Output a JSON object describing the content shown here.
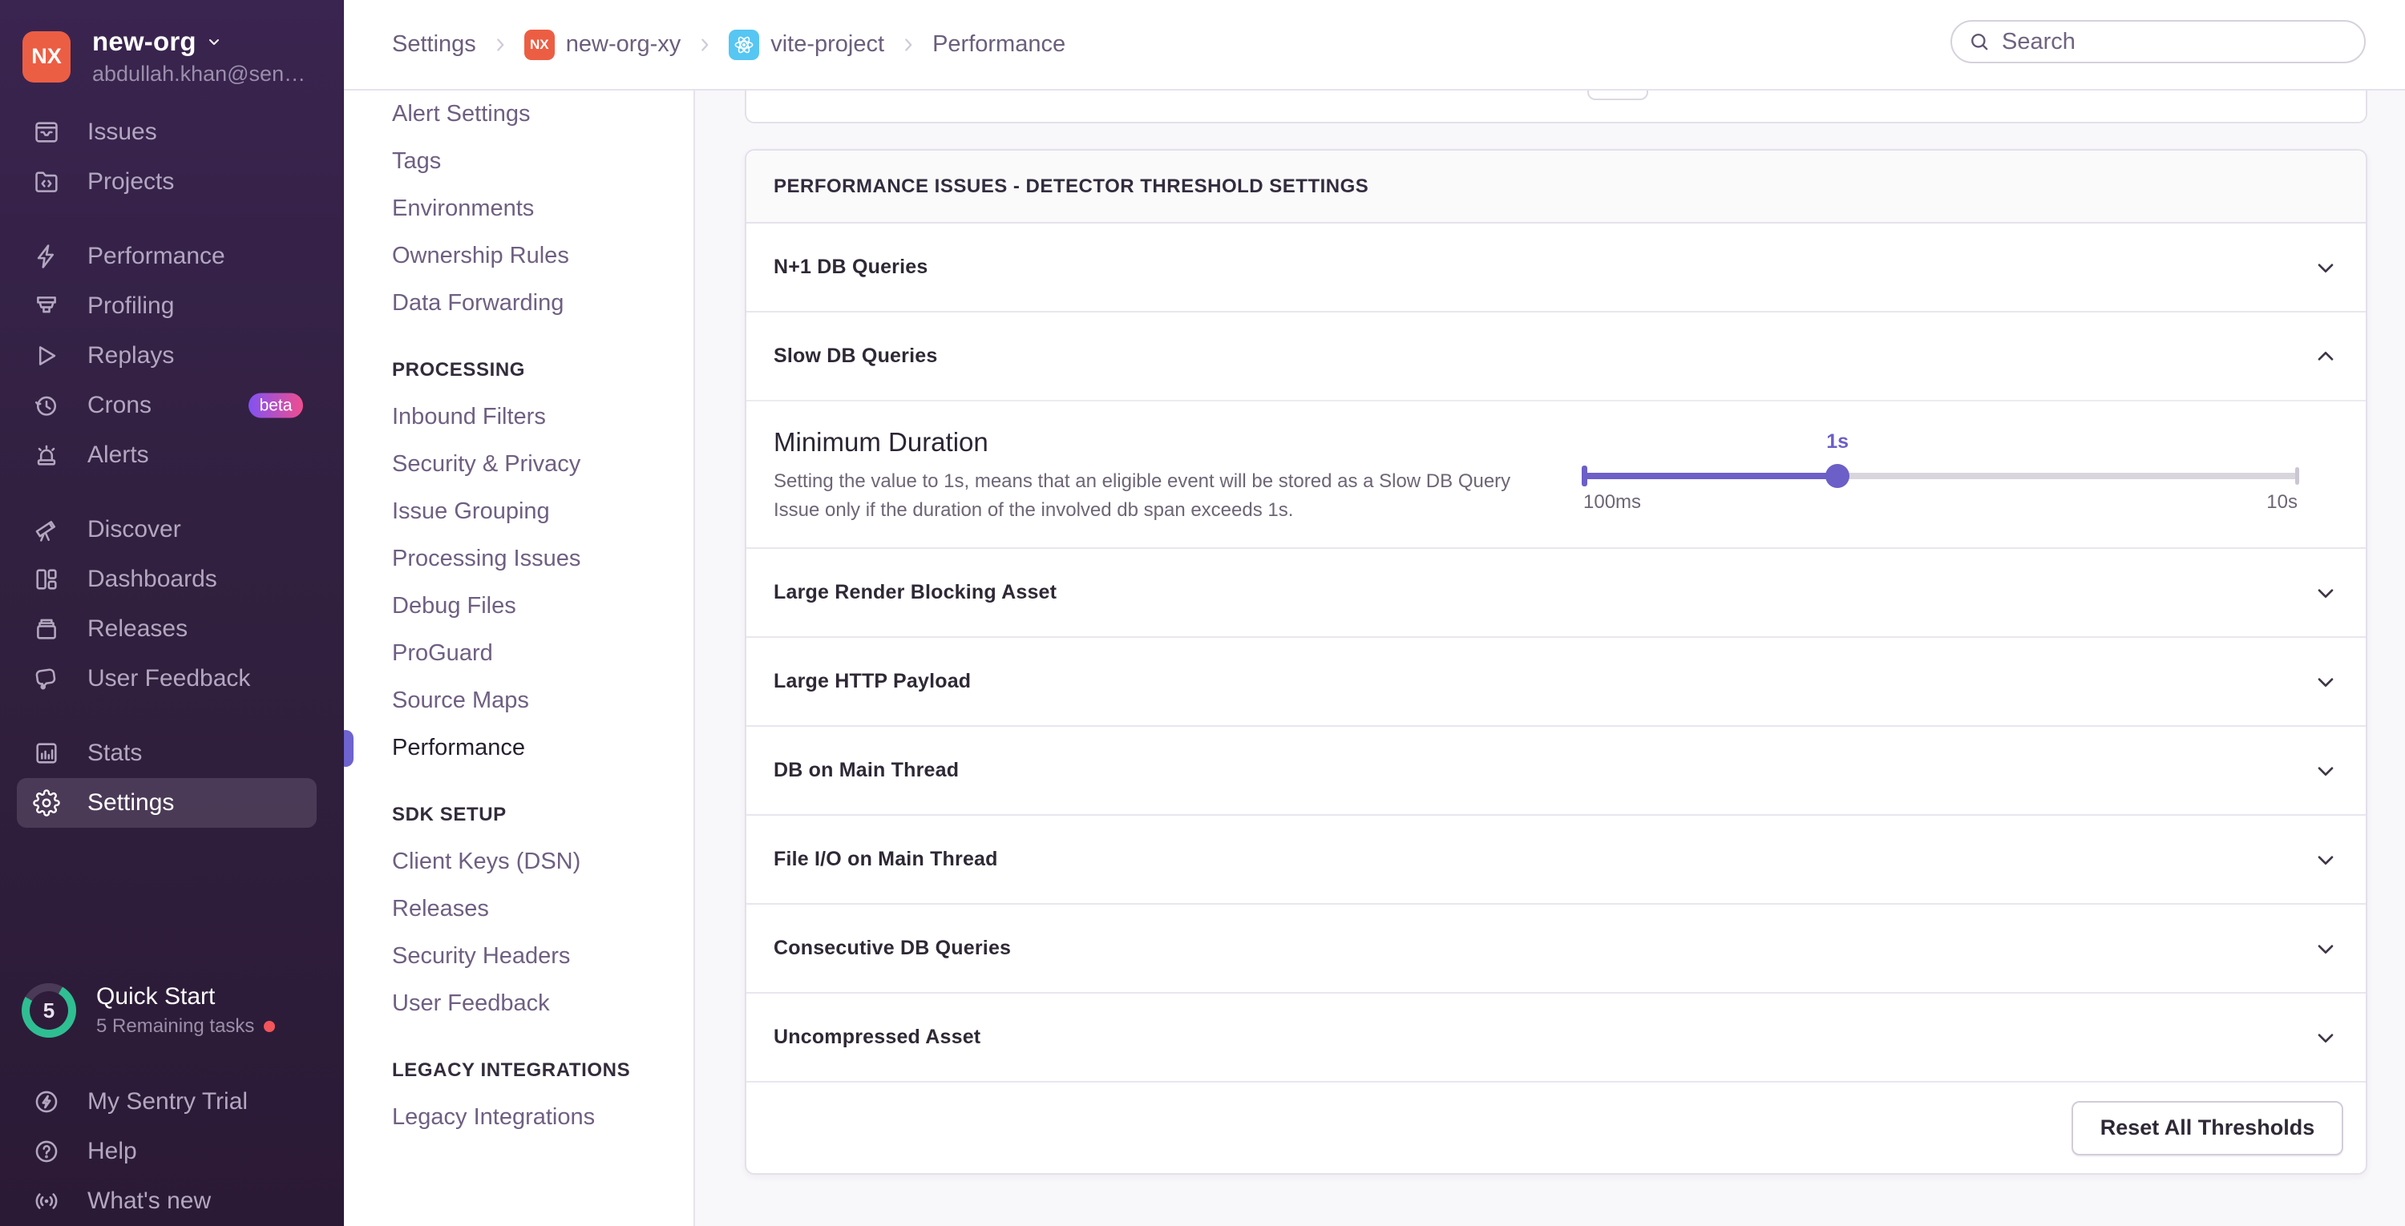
{
  "org": {
    "initials": "NX",
    "name": "new-org",
    "email": "abdullah.khan@sen…"
  },
  "sidebar": {
    "groups": [
      {
        "items": [
          {
            "label": "Issues",
            "icon": "issues-icon"
          },
          {
            "label": "Projects",
            "icon": "projects-icon"
          }
        ]
      },
      {
        "items": [
          {
            "label": "Performance",
            "icon": "performance-icon"
          },
          {
            "label": "Profiling",
            "icon": "profiling-icon"
          },
          {
            "label": "Replays",
            "icon": "replays-icon"
          },
          {
            "label": "Crons",
            "icon": "crons-icon",
            "badge": "beta"
          },
          {
            "label": "Alerts",
            "icon": "alerts-icon"
          }
        ]
      },
      {
        "items": [
          {
            "label": "Discover",
            "icon": "discover-icon"
          },
          {
            "label": "Dashboards",
            "icon": "dashboards-icon"
          },
          {
            "label": "Releases",
            "icon": "releases-icon"
          },
          {
            "label": "User Feedback",
            "icon": "user-feedback-icon"
          }
        ]
      },
      {
        "items": [
          {
            "label": "Stats",
            "icon": "stats-icon"
          },
          {
            "label": "Settings",
            "icon": "gear-icon",
            "active": true
          }
        ]
      }
    ],
    "quick_start": {
      "title": "Quick Start",
      "count": "5",
      "subtitle": "5 Remaining tasks"
    },
    "footer_items": [
      {
        "label": "My Sentry Trial",
        "icon": "trial-icon"
      },
      {
        "label": "Help",
        "icon": "help-icon"
      },
      {
        "label": "What's new",
        "icon": "broadcast-icon"
      }
    ]
  },
  "topbar": {
    "breadcrumbs": [
      {
        "label": "Settings"
      },
      {
        "label": "new-org-xy",
        "badge": "NX"
      },
      {
        "label": "vite-project",
        "badge": "react"
      },
      {
        "label": "Performance"
      }
    ],
    "search_placeholder": "Search"
  },
  "settings_nav": {
    "groups": [
      {
        "header": "",
        "items": [
          {
            "label": "Alert Settings"
          },
          {
            "label": "Tags"
          },
          {
            "label": "Environments"
          },
          {
            "label": "Ownership Rules"
          },
          {
            "label": "Data Forwarding"
          }
        ]
      },
      {
        "header": "PROCESSING",
        "items": [
          {
            "label": "Inbound Filters"
          },
          {
            "label": "Security & Privacy"
          },
          {
            "label": "Issue Grouping"
          },
          {
            "label": "Processing Issues"
          },
          {
            "label": "Debug Files"
          },
          {
            "label": "ProGuard"
          },
          {
            "label": "Source Maps"
          },
          {
            "label": "Performance",
            "active": true
          }
        ]
      },
      {
        "header": "SDK SETUP",
        "items": [
          {
            "label": "Client Keys (DSN)"
          },
          {
            "label": "Releases"
          },
          {
            "label": "Security Headers"
          },
          {
            "label": "User Feedback"
          }
        ]
      },
      {
        "header": "LEGACY INTEGRATIONS",
        "items": [
          {
            "label": "Legacy Integrations"
          }
        ]
      }
    ]
  },
  "panel": {
    "title": "PERFORMANCE ISSUES - DETECTOR THRESHOLD SETTINGS",
    "rows": [
      {
        "label": "N+1 DB Queries",
        "state": "collapsed"
      },
      {
        "label": "Slow DB Queries",
        "state": "expanded"
      },
      {
        "label": "Large Render Blocking Asset",
        "state": "collapsed"
      },
      {
        "label": "Large HTTP Payload",
        "state": "collapsed"
      },
      {
        "label": "DB on Main Thread",
        "state": "collapsed"
      },
      {
        "label": "File I/O on Main Thread",
        "state": "collapsed"
      },
      {
        "label": "Consecutive DB Queries",
        "state": "collapsed"
      },
      {
        "label": "Uncompressed Asset",
        "state": "collapsed"
      }
    ],
    "slow_db_detail": {
      "title": "Minimum Duration",
      "description": "Setting the value to 1s, means that an eligible event will be stored as a Slow DB Query Issue only if the duration of the involved db span exceeds 1s.",
      "slider": {
        "value_label": "1s",
        "min_label": "100ms",
        "max_label": "10s",
        "percent": 35.6
      }
    },
    "reset_button": "Reset All Thresholds"
  },
  "colors": {
    "accent_purple": "#6c5fc7",
    "avatar_orange": "#ec5e44",
    "react_blue": "#56c6f2",
    "beta_gradient_start": "#8152f2",
    "beta_gradient_end": "#ef4e8f",
    "quickstart_teal": "#2fbe92",
    "alert_red": "#f2555a"
  }
}
